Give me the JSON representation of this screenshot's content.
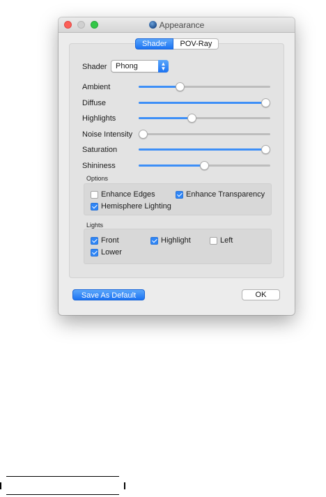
{
  "window": {
    "title": "Appearance",
    "icon": "appearance-icon"
  },
  "tabs": [
    {
      "label": "Shader",
      "active": true
    },
    {
      "label": "POV-Ray",
      "active": false
    }
  ],
  "shader": {
    "label": "Shader",
    "selected": "Phong",
    "stepper_glyph": "⌃⌄"
  },
  "sliders": [
    {
      "label": "Ambient",
      "value": 0.3
    },
    {
      "label": "Diffuse",
      "value": 1.0
    },
    {
      "label": "Highlights",
      "value": 0.4
    },
    {
      "label": "Noise Intensity",
      "value": 0.0
    },
    {
      "label": "Saturation",
      "value": 1.0
    },
    {
      "label": "Shininess",
      "value": 0.5
    }
  ],
  "options": {
    "title": "Options",
    "items": [
      {
        "label": "Enhance Edges",
        "checked": false
      },
      {
        "label": "Enhance Transparency",
        "checked": true
      },
      {
        "label": "Hemisphere Lighting",
        "checked": true
      }
    ]
  },
  "lights": {
    "title": "Lights",
    "items": [
      {
        "label": "Front",
        "checked": true
      },
      {
        "label": "Highlight",
        "checked": true
      },
      {
        "label": "Left",
        "checked": false
      },
      {
        "label": "Lower",
        "checked": true
      }
    ]
  },
  "buttons": {
    "save_default": "Save As Default",
    "ok": "OK"
  },
  "colors": {
    "accent": "#1c73f2",
    "close": "#fc5f57",
    "zoom": "#34c748"
  }
}
